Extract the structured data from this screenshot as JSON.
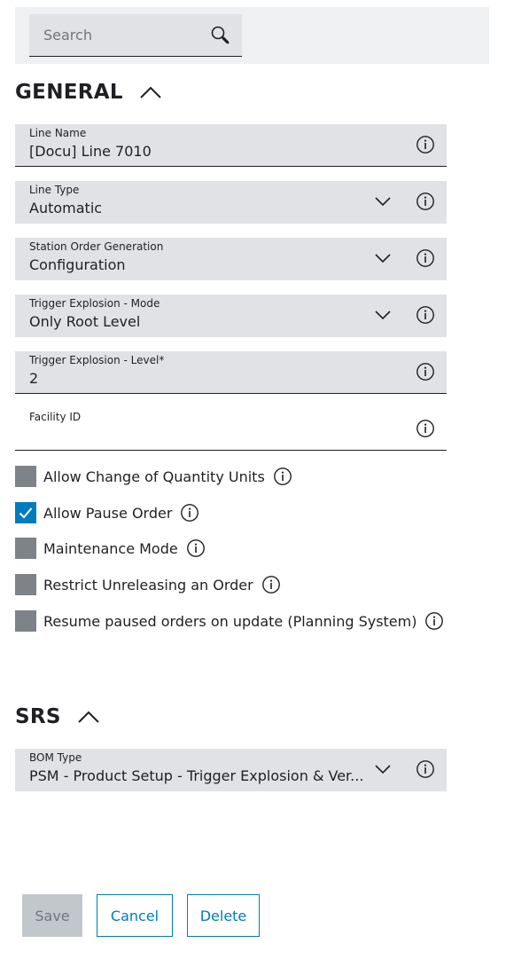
{
  "search": {
    "placeholder": "Search"
  },
  "general": {
    "title": "GENERAL",
    "fields": [
      {
        "label": "Line Name",
        "value": "[Docu] Line 7010"
      },
      {
        "label": "Line Type",
        "value": "Automatic"
      },
      {
        "label": "Station Order Generation",
        "value": "Configuration"
      },
      {
        "label": "Trigger Explosion - Mode",
        "value": "Only Root Level"
      },
      {
        "label": "Trigger Explosion - Level*",
        "value": "2"
      },
      {
        "label": "Facility ID",
        "value": ""
      }
    ],
    "checkboxes": [
      {
        "label": "Allow Change of Quantity Units",
        "checked": false
      },
      {
        "label": "Allow Pause Order",
        "checked": true
      },
      {
        "label": "Maintenance Mode",
        "checked": false
      },
      {
        "label": "Restrict Unreleasing an Order",
        "checked": false
      },
      {
        "label": "Resume paused orders on update (Planning System)",
        "checked": false
      }
    ]
  },
  "srs": {
    "title": "SRS",
    "fields": [
      {
        "label": "BOM Type",
        "value": "PSM - Product Setup - Trigger Explosion & Ver..."
      }
    ]
  },
  "buttons": {
    "save": "Save",
    "cancel": "Cancel",
    "delete": "Delete"
  },
  "colors": {
    "accent": "#007bc0",
    "field_bg": "#e0e2e5",
    "checkbox_off": "#7d8389"
  }
}
